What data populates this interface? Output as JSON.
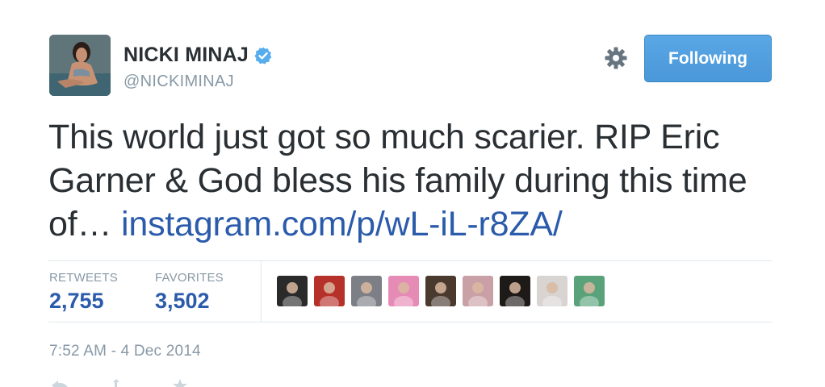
{
  "user": {
    "display_name": "NICKI MINAJ",
    "handle": "@NICKIMINAJ",
    "verified": true,
    "avatar_icon": "profile-photo"
  },
  "header": {
    "settings_icon": "gear-icon",
    "follow_label": "Following"
  },
  "tweet": {
    "text_before_link": "This world just got so much scarier. RIP Eric Garner & God bless his family during this time of… ",
    "link_text": "instagram.com/p/wL-iL-r8ZA/",
    "timestamp": "7:52 AM - 4 Dec 2014"
  },
  "stats": {
    "retweets_label": "RETWEETS",
    "retweets_value": "2,755",
    "favorites_label": "FAVORITES",
    "favorites_value": "3,502"
  },
  "favoriters": [
    {
      "icon": "user-avatar",
      "color": "#2a2a2a"
    },
    {
      "icon": "user-avatar",
      "color": "#b5312a"
    },
    {
      "icon": "user-avatar",
      "color": "#7d7f86"
    },
    {
      "icon": "user-avatar",
      "color": "#e68bb5"
    },
    {
      "icon": "user-avatar",
      "color": "#4a3a2e"
    },
    {
      "icon": "user-avatar",
      "color": "#c9a0a6"
    },
    {
      "icon": "user-avatar",
      "color": "#1e1a18"
    },
    {
      "icon": "user-avatar",
      "color": "#d8d4d2"
    },
    {
      "icon": "user-avatar",
      "color": "#5aa37a"
    }
  ],
  "colors": {
    "link": "#2b5bab",
    "follow_button": "#4a97d9",
    "muted_text": "#8899a6",
    "verified_badge": "#55acee"
  },
  "actions": [
    "reply-icon",
    "retweet-icon",
    "favorite-icon"
  ]
}
